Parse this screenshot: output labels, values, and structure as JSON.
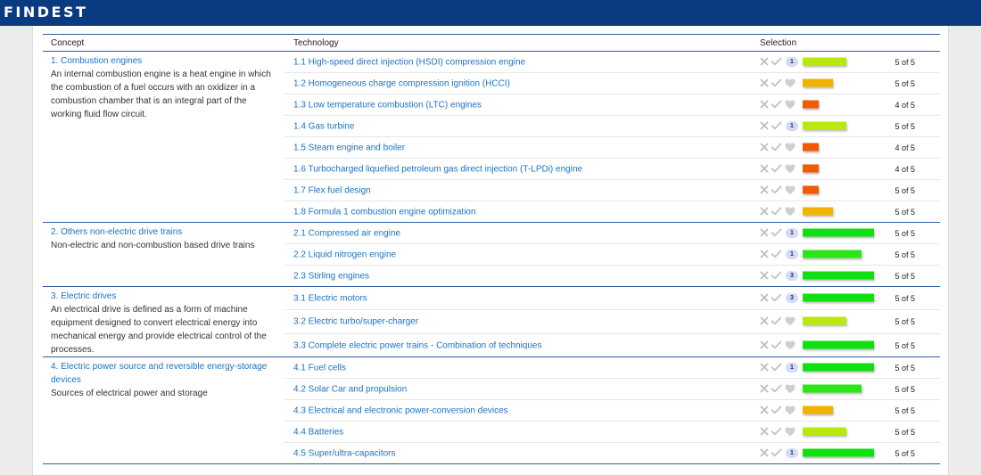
{
  "brand": {
    "logo": "FINDEST"
  },
  "table": {
    "headers": {
      "concept": "Concept",
      "technology": "Technology",
      "selection": "Selection"
    },
    "groups": [
      {
        "title": "1. Combustion engines",
        "description": "An internal combustion engine is a heat engine in which the combustion of a fuel occurs with an oxidizer in a combustion chamber that is an integral part of the working fluid flow circuit.",
        "rows": [
          {
            "label": "1.1 High-speed direct injection (HSDI) compression engine",
            "badge": "1",
            "score": 0.6,
            "color": "#b9e80c",
            "count": "5 of 5"
          },
          {
            "label": "1.2 Homogeneous charge compression ignition (HCCI)",
            "badge": "",
            "score": 0.42,
            "color": "#f0b400",
            "count": "5 of 5"
          },
          {
            "label": "1.3 Low temperature combustion (LTC) engines",
            "badge": "",
            "score": 0.22,
            "color": "#f05a00",
            "count": "4 of 5"
          },
          {
            "label": "1.4 Gas turbine",
            "badge": "1",
            "score": 0.6,
            "color": "#b9e80c",
            "count": "5 of 5"
          },
          {
            "label": "1.5 Steam engine and boiler",
            "badge": "",
            "score": 0.22,
            "color": "#f05a00",
            "count": "4 of 5"
          },
          {
            "label": "1.6 Turbocharged liquefied petroleum gas direct injection (T-LPDi) engine",
            "badge": "",
            "score": 0.22,
            "color": "#f05a00",
            "count": "4 of 5"
          },
          {
            "label": "1.7 Flex fuel design",
            "badge": "",
            "score": 0.22,
            "color": "#f05a00",
            "count": "5 of 5"
          },
          {
            "label": "1.8 Formula 1 combustion engine optimization",
            "badge": "",
            "score": 0.42,
            "color": "#f0b400",
            "count": "5 of 5"
          }
        ]
      },
      {
        "title": "2. Others non-electric drive trains",
        "description": "Non-electric and non-combustion based drive trains",
        "rows": [
          {
            "label": "2.1 Compressed air engine",
            "badge": "1",
            "score": 0.98,
            "color": "#10e010",
            "count": "5 of 5"
          },
          {
            "label": "2.2 Liquid nitrogen engine",
            "badge": "1",
            "score": 0.8,
            "color": "#2de61a",
            "count": "5 of 5"
          },
          {
            "label": "2.3 Stirling engines",
            "badge": "3",
            "score": 0.98,
            "color": "#10e010",
            "count": "5 of 5"
          }
        ]
      },
      {
        "title": "3. Electric drives",
        "description": "An electrical drive is defined as a form of machine equipment designed to convert electrical energy into mechanical energy and provide electrical control of the processes.",
        "rows": [
          {
            "label": "3.1 Electric motors",
            "badge": "3",
            "score": 0.98,
            "color": "#10e010",
            "count": "5 of 5"
          },
          {
            "label": "3.2 Electric turbo/super-charger",
            "badge": "",
            "score": 0.6,
            "color": "#b9e80c",
            "count": "5 of 5"
          },
          {
            "label": "3.3 Complete electric power trains - Combination of techniques",
            "badge": "",
            "score": 0.98,
            "color": "#10e010",
            "count": "5 of 5"
          }
        ]
      },
      {
        "title": "4. Electric power source and reversible energy-storage devices",
        "description": "Sources of electrical power and storage",
        "rows": [
          {
            "label": "4.1 Fuel cells",
            "badge": "1",
            "score": 0.98,
            "color": "#10e010",
            "count": "5 of 5"
          },
          {
            "label": "4.2 Solar Car and propulsion",
            "badge": "",
            "score": 0.8,
            "color": "#2de61a",
            "count": "5 of 5"
          },
          {
            "label": "4.3 Electrical and electronic power-conversion devices",
            "badge": "",
            "score": 0.42,
            "color": "#f0b400",
            "count": "5 of 5"
          },
          {
            "label": "4.4 Batteries",
            "badge": "",
            "score": 0.6,
            "color": "#b9e80c",
            "count": "5 of 5"
          },
          {
            "label": "4.5 Super/ultra-capacitors",
            "badge": "1",
            "score": 0.98,
            "color": "#10e010",
            "count": "5 of 5"
          }
        ]
      }
    ]
  },
  "icons": {
    "reject": "close-icon",
    "accept": "check-icon",
    "like": "heart-icon",
    "comments": "comment-badge-icon"
  }
}
